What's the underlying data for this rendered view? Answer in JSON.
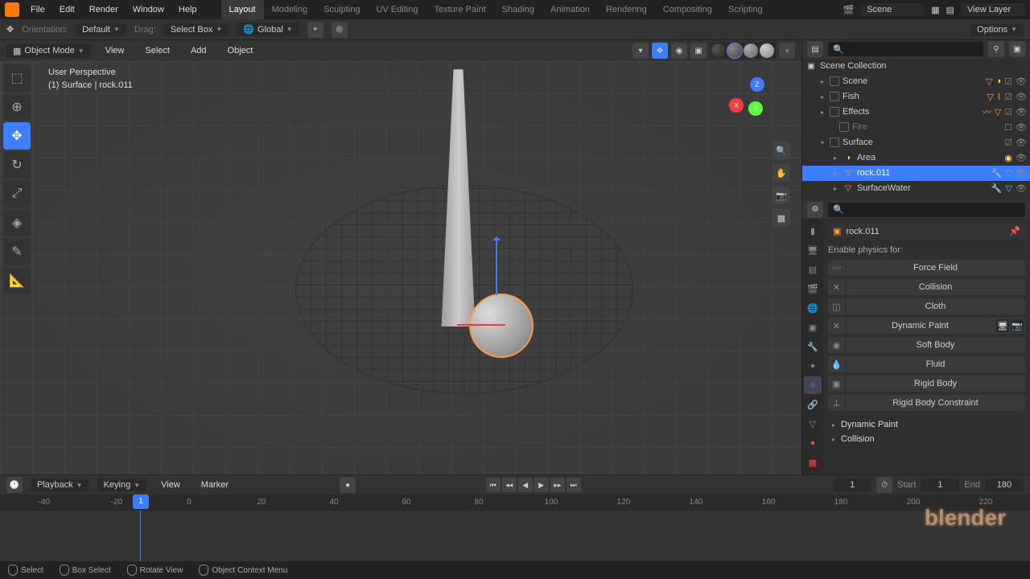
{
  "menu": [
    "File",
    "Edit",
    "Render",
    "Window",
    "Help"
  ],
  "workspaces": [
    "Layout",
    "Modeling",
    "Sculpting",
    "UV Editing",
    "Texture Paint",
    "Shading",
    "Animation",
    "Rendering",
    "Compositing",
    "Scripting"
  ],
  "activeWorkspace": "Layout",
  "sceneName": "Scene",
  "viewLayer": "View Layer",
  "toolbar2": {
    "orientation": "Orientation:",
    "orientationValue": "Default",
    "drag": "Drag:",
    "dragValue": "Select Box",
    "transform": "Global",
    "options": "Options"
  },
  "viewportHeader": {
    "mode": "Object Mode",
    "menus": [
      "View",
      "Select",
      "Add",
      "Object"
    ]
  },
  "hud": {
    "line1": "User Perspective",
    "line2": "(1) Surface | rock.011"
  },
  "axes": {
    "x": "X",
    "y": "Y",
    "z": "Z"
  },
  "outliner": {
    "root": "Scene Collection",
    "items": [
      {
        "label": "Scene",
        "type": "collection",
        "indent": 1
      },
      {
        "label": "Fish",
        "type": "collection",
        "indent": 1
      },
      {
        "label": "Effects",
        "type": "collection",
        "indent": 1
      },
      {
        "label": "Fire",
        "type": "collection",
        "indent": 2
      },
      {
        "label": "Surface",
        "type": "collection",
        "indent": 1,
        "open": true
      },
      {
        "label": "Area",
        "type": "light",
        "indent": 2
      },
      {
        "label": "rock.011",
        "type": "mesh",
        "indent": 2,
        "active": true
      },
      {
        "label": "SurfaceWater",
        "type": "mesh",
        "indent": 2
      }
    ]
  },
  "props": {
    "activeObject": "rock.011",
    "enablePhysics": "Enable physics for:",
    "physics": [
      "Force Field",
      "Collision",
      "Cloth",
      "Dynamic Paint",
      "Soft Body",
      "Fluid",
      "Rigid Body",
      "Rigid Body Constraint"
    ],
    "panels": [
      "Dynamic Paint",
      "Collision"
    ]
  },
  "timeline": {
    "menus": [
      "Playback",
      "Keying",
      "View",
      "Marker"
    ],
    "currentFrame": "1",
    "startLabel": "Start",
    "start": "1",
    "endLabel": "End",
    "end": "180",
    "ticks": [
      "-40",
      "-20",
      "0",
      "20",
      "40",
      "60",
      "80",
      "100",
      "120",
      "140",
      "160",
      "180",
      "200",
      "220"
    ],
    "playhead": "1"
  },
  "status": {
    "select": "Select",
    "boxSelect": "Box Select",
    "rotateView": "Rotate View",
    "contextMenu": "Object Context Menu"
  },
  "watermark": "blender"
}
